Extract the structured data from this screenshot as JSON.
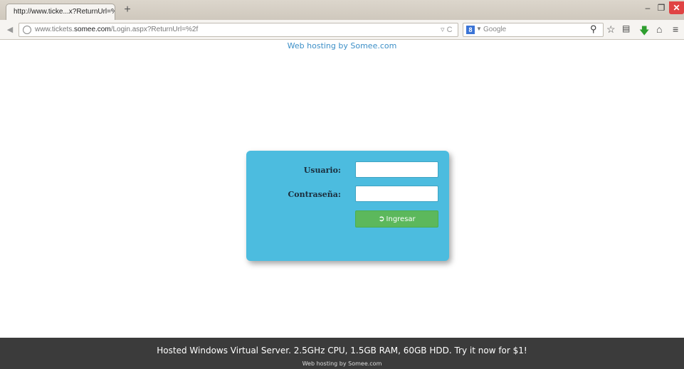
{
  "browser": {
    "tab_title": "http://www.ticke...x?ReturnUrl=%2f",
    "new_tab": "+",
    "url_prefix": "www.tickets.",
    "url_domain": "somee.com",
    "url_path": "/Login.aspx?ReturnUrl=%2f",
    "search_placeholder": "Google",
    "search_engine_icon": "google-icon",
    "window_controls": {
      "minimize": "–",
      "maximize": "❐",
      "close": "✕"
    },
    "toolbar_icons": [
      "search-icon",
      "star-icon",
      "reading-list-icon",
      "download-icon",
      "home-icon",
      "menu-icon"
    ]
  },
  "page": {
    "top_link": "Web hosting by Somee.com",
    "login": {
      "username_label": "Usuario:",
      "password_label": "Contraseña:",
      "username_value": "",
      "password_value": "",
      "submit_label": "Ingresar",
      "submit_icon": "sign-in-icon"
    },
    "footer": {
      "main": "Hosted Windows Virtual Server. 2.5GHz CPU, 1.5GB RAM, 60GB HDD. Try it now for $1!",
      "sub": "Web hosting by Somee.com"
    }
  },
  "colors": {
    "login_panel": "#4cbcdf",
    "login_button": "#5cb85c",
    "footer_bg": "#3b3b3b",
    "link": "#3c8fc7"
  }
}
